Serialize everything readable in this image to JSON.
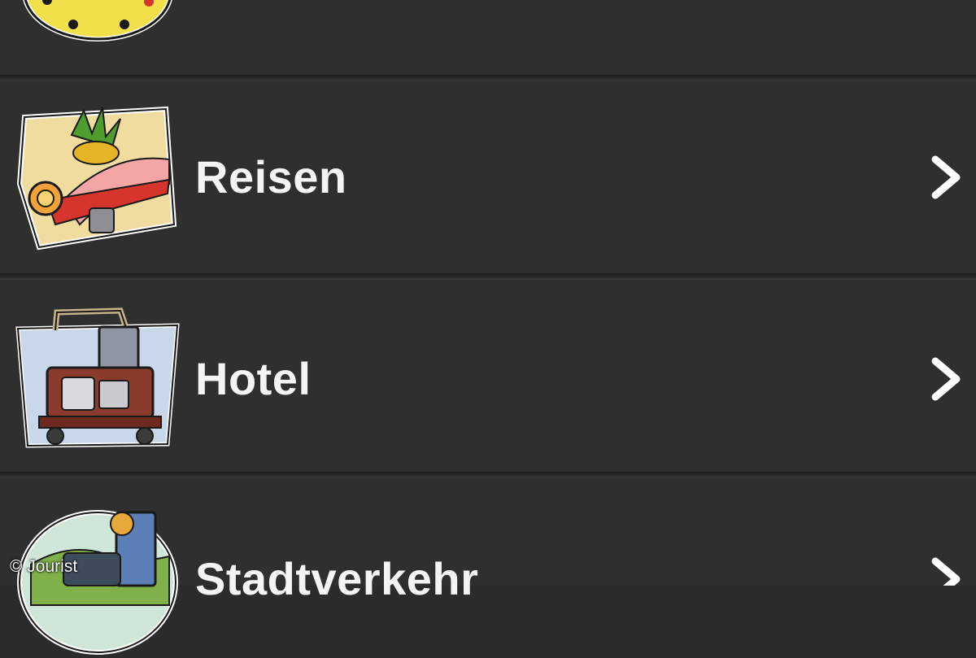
{
  "list": {
    "items": [
      {
        "label": "",
        "icon": "clock-icon",
        "chevron": "chevron-right-icon"
      },
      {
        "label": "Reisen",
        "icon": "travel-beach-icon",
        "chevron": "chevron-right-icon"
      },
      {
        "label": "Hotel",
        "icon": "hotel-luggage-cart-icon",
        "chevron": "chevron-right-icon"
      },
      {
        "label": "Stadtverkehr",
        "icon": "city-traffic-icon",
        "chevron": "chevron-right-icon"
      }
    ]
  },
  "copyright": "© Jourist",
  "colors": {
    "background": "#2b2b2b",
    "row": "#2f2f2f",
    "text": "#f4f4f4"
  }
}
